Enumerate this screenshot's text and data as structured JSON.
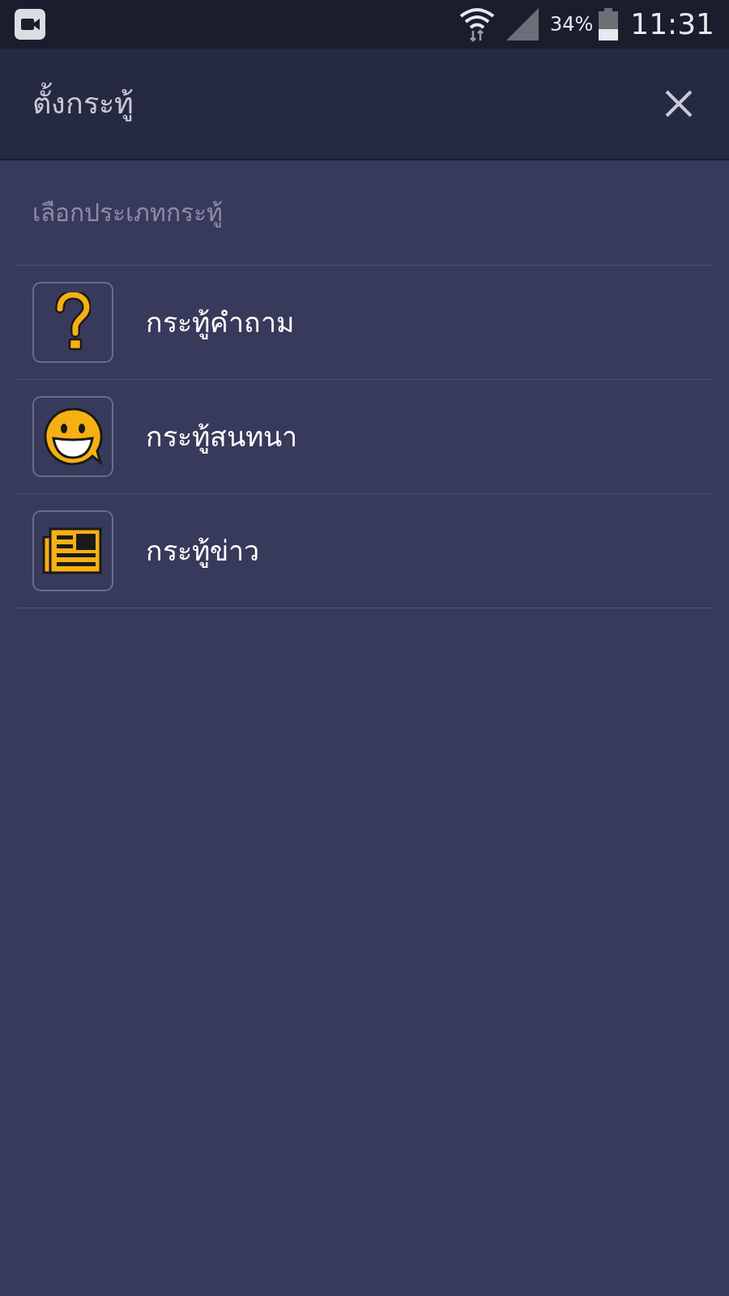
{
  "status_bar": {
    "battery": "34%",
    "time": "11:31"
  },
  "header": {
    "title": "ตั้งกระทู้"
  },
  "section_label": "เลือกประเภทกระทู้",
  "items": [
    {
      "kind": "question",
      "label": "กระทู้คำถาม"
    },
    {
      "kind": "chat",
      "label": "กระทู้สนทนา"
    },
    {
      "kind": "news",
      "label": "กระทู้ข่าว"
    }
  ]
}
